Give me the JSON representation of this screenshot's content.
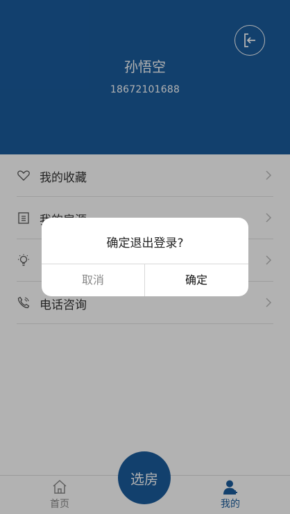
{
  "colors": {
    "primary": "#1a5c9d",
    "overlay": "rgba(0,0,0,0.30)"
  },
  "profile": {
    "name": "孙悟空",
    "phone": "18672101688",
    "logout_icon": "logout-icon"
  },
  "menu": {
    "items": [
      {
        "label": "我的收藏",
        "icon": "heart-icon"
      },
      {
        "label": "我的房源",
        "icon": "building-icon"
      },
      {
        "label": "",
        "icon": "lightbulb-icon"
      },
      {
        "label": "电话咨询",
        "icon": "phone-icon"
      }
    ]
  },
  "tabbar": {
    "home_label": "首页",
    "center_label": "选房",
    "mine_label": "我的",
    "active": "我的"
  },
  "dialog": {
    "title": "确定退出登录?",
    "cancel_label": "取消",
    "confirm_label": "确定"
  }
}
